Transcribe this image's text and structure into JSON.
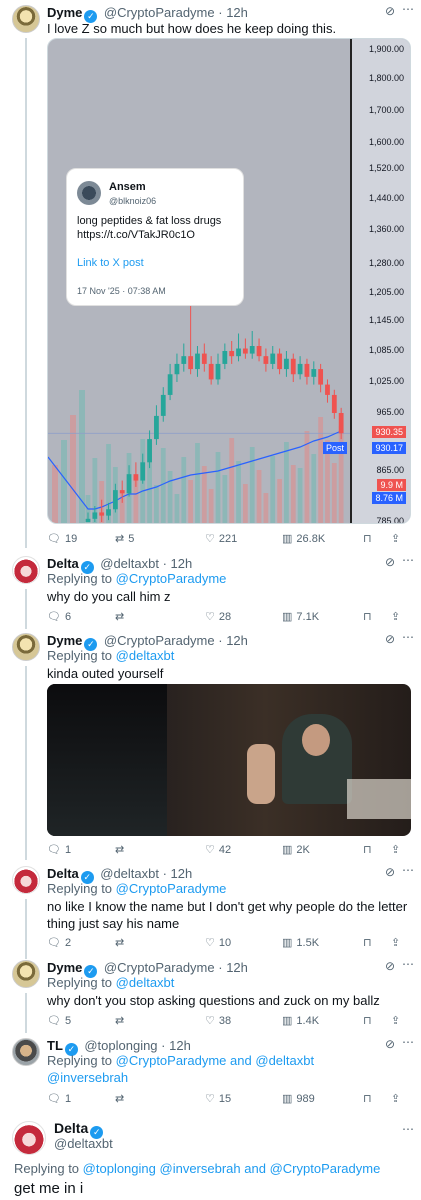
{
  "tweets": [
    {
      "name": "Dyme",
      "handle": "@CryptoParadyme",
      "time": "12h",
      "text": "I love Z so much but how does he keep doing this.",
      "stats": {
        "replies": "19",
        "reposts": "5",
        "likes": "221",
        "views": "26.8K"
      }
    },
    {
      "name": "Delta",
      "handle": "@deltaxbt",
      "time": "12h",
      "replying_label": "Replying to",
      "replying_to": "@CryptoParadyme",
      "text": "why do you call him z",
      "stats": {
        "replies": "6",
        "reposts": "",
        "likes": "28",
        "views": "7.1K"
      }
    },
    {
      "name": "Dyme",
      "handle": "@CryptoParadyme",
      "time": "12h",
      "replying_label": "Replying to",
      "replying_to": "@deltaxbt",
      "text": "kinda outed yourself",
      "stats": {
        "replies": "1",
        "reposts": "",
        "likes": "42",
        "views": "2K"
      }
    },
    {
      "name": "Delta",
      "handle": "@deltaxbt",
      "time": "12h",
      "replying_label": "Replying to",
      "replying_to": "@CryptoParadyme",
      "text_line1": "no like I know the name but I don't get why people do the letter",
      "text_line2": "thing just say his name",
      "stats": {
        "replies": "2",
        "reposts": "",
        "likes": "10",
        "views": "1.5K"
      }
    },
    {
      "name": "Dyme",
      "handle": "@CryptoParadyme",
      "time": "12h",
      "replying_label": "Replying to",
      "replying_to": "@deltaxbt",
      "text": "why don't you stop asking questions and zuck on my ballz",
      "stats": {
        "replies": "5",
        "reposts": "",
        "likes": "38",
        "views": "1.4K"
      }
    },
    {
      "name": "TL",
      "handle": "@toplonging",
      "time": "12h",
      "replying_label": "Replying to",
      "replying_to_1": "@CryptoParadyme",
      "replying_and": "and",
      "replying_to_2": "@deltaxbt",
      "replying_to_3": "@inversebrah",
      "stats": {
        "replies": "1",
        "reposts": "",
        "likes": "15",
        "views": "989"
      }
    }
  ],
  "compose": {
    "name": "Delta",
    "handle": "@deltaxbt",
    "replying_label": "Replying to",
    "replying_to_1": "@toplonging",
    "replying_to_2": "@inversebrah",
    "replying_and": "and",
    "replying_to_3": "@CryptoParadyme",
    "text": "get me in i"
  },
  "embed": {
    "name": "Ansem",
    "handle": "@blknoiz06",
    "text_line1": "long peptides & fat loss drugs",
    "text_line2": "https://t.co/VTakJR0c1O",
    "link_label": "Link to X post",
    "date": "17 Nov '25 · 07:38 AM"
  },
  "colors": {
    "accent": "#1d9bf0",
    "up": "#26a69a",
    "down": "#ef5350"
  },
  "chart_data": {
    "type": "candlestick",
    "y_tick_labels": [
      "1,900.00",
      "1,800.00",
      "1,700.00",
      "1,600.00",
      "1,520.00",
      "1,440.00",
      "1,360.00",
      "1,280.00",
      "1,205.00",
      "1,145.00",
      "1,085.00",
      "1,025.00",
      "965.00",
      "865.00",
      "785.00"
    ],
    "price_tags": [
      {
        "label": "930.35",
        "color": "#ef5350"
      },
      {
        "label": "Post",
        "value": "930.17",
        "color": "#2962ff"
      },
      {
        "label": "9.9 M",
        "color": "#ef5350"
      },
      {
        "label": "8.76 M",
        "color": "#2962ff"
      }
    ],
    "candles": [
      {
        "o": 785,
        "c": 790,
        "h": 800,
        "l": 775
      },
      {
        "o": 790,
        "c": 800,
        "h": 810,
        "l": 780
      },
      {
        "o": 800,
        "c": 795,
        "h": 820,
        "l": 785
      },
      {
        "o": 795,
        "c": 805,
        "h": 815,
        "l": 788
      },
      {
        "o": 805,
        "c": 835,
        "h": 845,
        "l": 800
      },
      {
        "o": 835,
        "c": 830,
        "h": 850,
        "l": 815
      },
      {
        "o": 830,
        "c": 860,
        "h": 875,
        "l": 825
      },
      {
        "o": 860,
        "c": 850,
        "h": 880,
        "l": 840
      },
      {
        "o": 850,
        "c": 880,
        "h": 895,
        "l": 845
      },
      {
        "o": 880,
        "c": 920,
        "h": 935,
        "l": 870
      },
      {
        "o": 920,
        "c": 960,
        "h": 980,
        "l": 910
      },
      {
        "o": 960,
        "c": 1000,
        "h": 1015,
        "l": 950
      },
      {
        "o": 1000,
        "c": 1040,
        "h": 1060,
        "l": 990
      },
      {
        "o": 1040,
        "c": 1060,
        "h": 1080,
        "l": 1025
      },
      {
        "o": 1060,
        "c": 1075,
        "h": 1100,
        "l": 1045
      },
      {
        "o": 1075,
        "c": 1050,
        "h": 1230,
        "l": 1040
      },
      {
        "o": 1050,
        "c": 1080,
        "h": 1095,
        "l": 1035
      },
      {
        "o": 1080,
        "c": 1060,
        "h": 1100,
        "l": 1045
      },
      {
        "o": 1060,
        "c": 1030,
        "h": 1075,
        "l": 1020
      },
      {
        "o": 1030,
        "c": 1060,
        "h": 1080,
        "l": 1020
      },
      {
        "o": 1060,
        "c": 1085,
        "h": 1100,
        "l": 1050
      },
      {
        "o": 1085,
        "c": 1075,
        "h": 1105,
        "l": 1060
      },
      {
        "o": 1075,
        "c": 1090,
        "h": 1120,
        "l": 1065
      },
      {
        "o": 1090,
        "c": 1080,
        "h": 1110,
        "l": 1070
      },
      {
        "o": 1080,
        "c": 1095,
        "h": 1125,
        "l": 1070
      },
      {
        "o": 1095,
        "c": 1075,
        "h": 1110,
        "l": 1065
      },
      {
        "o": 1075,
        "c": 1060,
        "h": 1090,
        "l": 1045
      },
      {
        "o": 1060,
        "c": 1080,
        "h": 1095,
        "l": 1050
      },
      {
        "o": 1080,
        "c": 1050,
        "h": 1090,
        "l": 1040
      },
      {
        "o": 1050,
        "c": 1070,
        "h": 1085,
        "l": 1035
      },
      {
        "o": 1070,
        "c": 1040,
        "h": 1080,
        "l": 1025
      },
      {
        "o": 1040,
        "c": 1060,
        "h": 1075,
        "l": 1030
      },
      {
        "o": 1060,
        "c": 1035,
        "h": 1070,
        "l": 1020
      },
      {
        "o": 1035,
        "c": 1050,
        "h": 1065,
        "l": 1020
      },
      {
        "o": 1050,
        "c": 1020,
        "h": 1060,
        "l": 1005
      },
      {
        "o": 1020,
        "c": 1000,
        "h": 1030,
        "l": 985
      },
      {
        "o": 1000,
        "c": 965,
        "h": 1010,
        "l": 955
      },
      {
        "o": 965,
        "c": 930,
        "h": 975,
        "l": 920
      }
    ],
    "volume_ma": [
      470,
      470,
      468,
      465,
      462,
      458,
      455,
      455,
      452,
      450,
      448,
      445,
      442,
      440,
      438,
      436,
      435,
      434,
      433,
      432,
      430,
      428,
      426,
      424,
      422,
      420,
      418,
      416,
      414,
      412,
      410,
      408,
      405,
      402,
      400,
      398,
      395,
      392
    ]
  }
}
